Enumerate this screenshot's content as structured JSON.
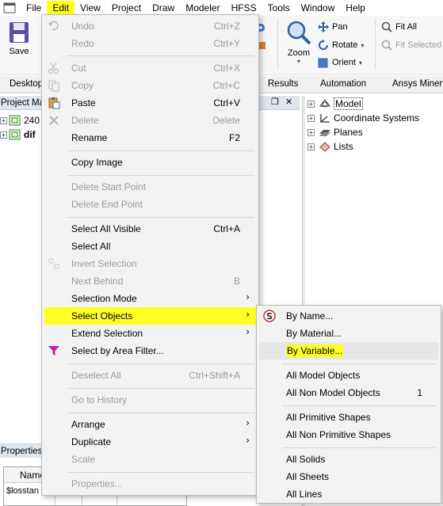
{
  "menubar": {
    "items": [
      "File",
      "Edit",
      "View",
      "Project",
      "Draw",
      "Modeler",
      "HFSS",
      "Tools",
      "Window",
      "Help"
    ]
  },
  "ribbon": {
    "save": "Save",
    "zoom": "Zoom",
    "pan": "Pan",
    "rotate": "Rotate",
    "orient": "Orient",
    "fit_all": "Fit All",
    "fit_selected": "Fit Selected"
  },
  "tabs": {
    "desktop": "Desktop",
    "results": "Results",
    "automation": "Automation",
    "ansys_minerva": "Ansys Minerva"
  },
  "project_panel": {
    "title": "Project Ma",
    "items": [
      "240",
      "dif"
    ]
  },
  "mid_panel": {
    "pin": "❐",
    "close": "✕"
  },
  "model_tree": {
    "items": [
      "Model",
      "Coordinate Systems",
      "Planes",
      "Lists"
    ]
  },
  "properties_panel": {
    "title": "Properties",
    "column": "Name",
    "value": "$losstan"
  },
  "edit_menu": {
    "undo": {
      "label": "Undo",
      "shortcut": "Ctrl+Z"
    },
    "redo": {
      "label": "Redo",
      "shortcut": "Ctrl+Y"
    },
    "cut": {
      "label": "Cut",
      "shortcut": "Ctrl+X"
    },
    "copy": {
      "label": "Copy",
      "shortcut": "Ctrl+C"
    },
    "paste": {
      "label": "Paste",
      "shortcut": "Ctrl+V"
    },
    "delete": {
      "label": "Delete",
      "shortcut": "Delete"
    },
    "rename": {
      "label": "Rename",
      "shortcut": "F2"
    },
    "copy_image": {
      "label": "Copy Image"
    },
    "delete_start_point": {
      "label": "Delete Start Point"
    },
    "delete_end_point": {
      "label": "Delete End Point"
    },
    "select_all_visible": {
      "label": "Select All Visible",
      "shortcut": "Ctrl+A"
    },
    "select_all": {
      "label": "Select All"
    },
    "invert_selection": {
      "label": "Invert Selection"
    },
    "next_behind": {
      "label": "Next Behind",
      "shortcut": "B"
    },
    "selection_mode": {
      "label": "Selection Mode"
    },
    "select_objects": {
      "label": "Select Objects"
    },
    "extend_selection": {
      "label": "Extend Selection"
    },
    "select_by_area_filter": {
      "label": "Select by Area Filter..."
    },
    "deselect_all": {
      "label": "Deselect All",
      "shortcut": "Ctrl+Shift+A"
    },
    "go_to_history": {
      "label": "Go to History"
    },
    "arrange": {
      "label": "Arrange"
    },
    "duplicate": {
      "label": "Duplicate"
    },
    "scale": {
      "label": "Scale"
    },
    "properties": {
      "label": "Properties..."
    },
    "submenu_arrow": "›"
  },
  "select_objects_submenu": {
    "by_name": "By Name...",
    "by_material": "By Material...",
    "by_variable": "By Variable...",
    "all_model_objects": "All Model Objects",
    "all_non_model_objects": "All Non Model Objects",
    "all_non_model_objects_shortcut": "1",
    "all_primitive_shapes": "All Primitive Shapes",
    "all_non_primitive_shapes": "All Non Primitive Shapes",
    "all_solids": "All Solids",
    "all_sheets": "All Sheets",
    "all_lines": "All Lines"
  },
  "colors": {
    "highlight": "#ffff22",
    "disabled_text": "#9b9b9b"
  }
}
